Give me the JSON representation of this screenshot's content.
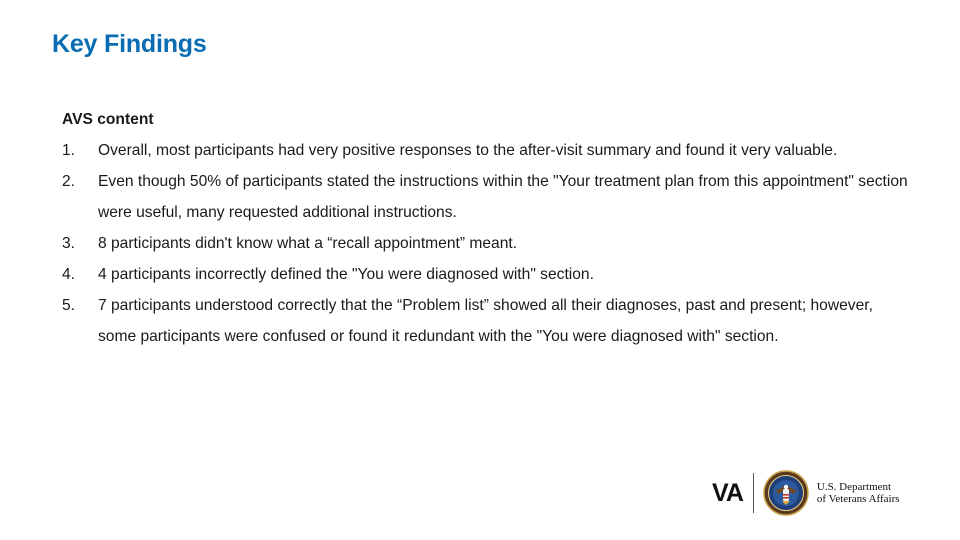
{
  "slide": {
    "title": "Key Findings",
    "section_heading": "AVS content",
    "findings": [
      {
        "number": "1.",
        "text": "Overall, most participants had very positive responses to the after-visit summary and found it very valuable."
      },
      {
        "number": "2.",
        "text": "Even though 50% of participants stated the instructions within the \"Your treatment plan from this appointment\" section were useful, many requested additional instructions."
      },
      {
        "number": "3.",
        "text": "8 participants didn't know what a “recall appointment” meant."
      },
      {
        "number": "4.",
        "text": "4 participants incorrectly defined the \"You were diagnosed with\" section."
      },
      {
        "number": "5.",
        "text": "7 participants understood correctly that the “Problem list” showed all their diagnoses, past and present; however, some participants were confused or found it redundant with the \"You were diagnosed with\" section."
      }
    ]
  },
  "logo": {
    "mark": "VA",
    "department_line1": "U.S. Department",
    "department_line2": "of Veterans Affairs",
    "seal_icon": "va-seal-icon"
  },
  "colors": {
    "title": "#0a6cb3",
    "body_text": "#1a1a1a"
  }
}
